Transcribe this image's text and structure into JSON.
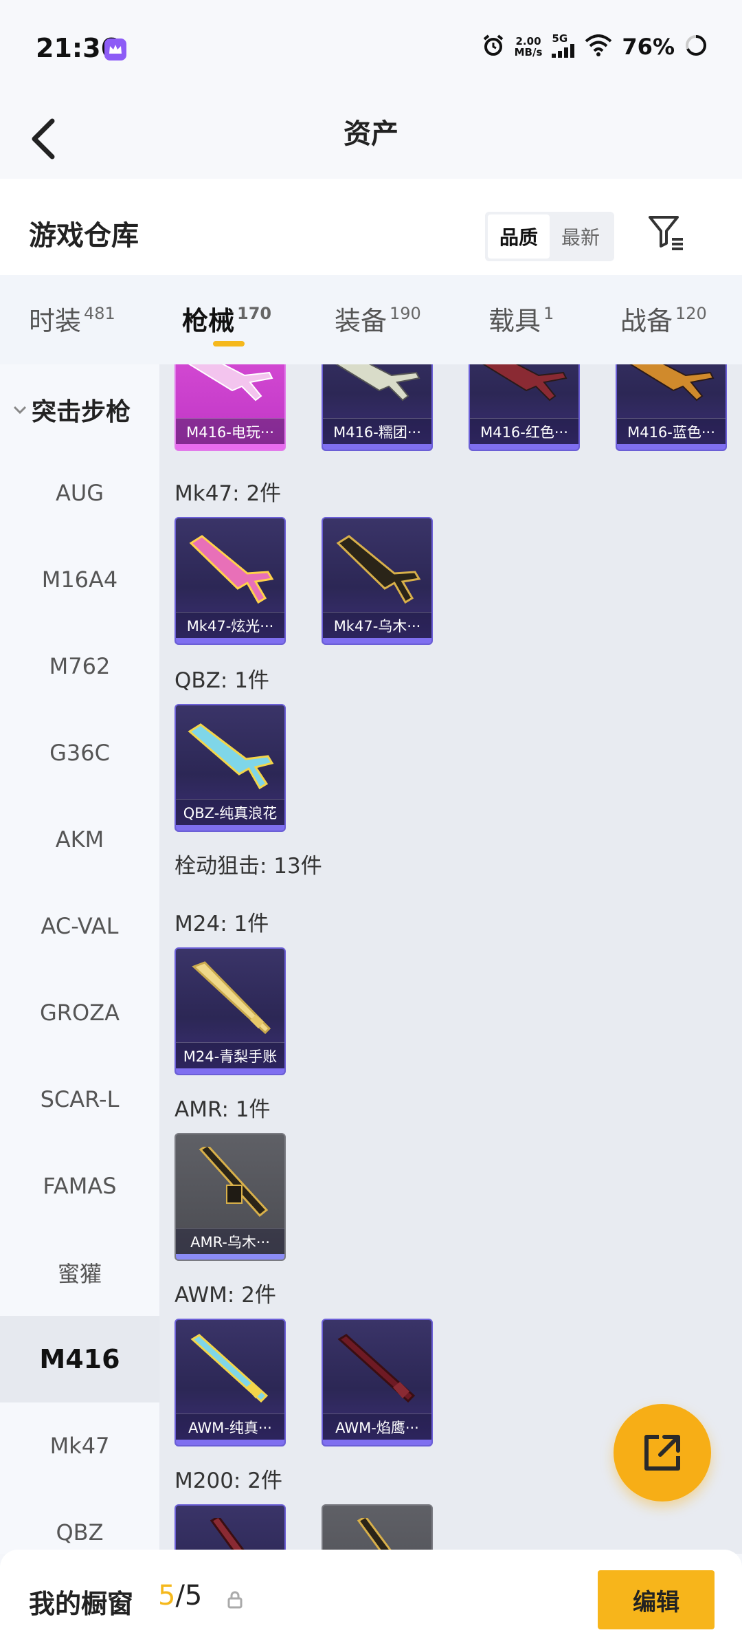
{
  "status_bar": {
    "time": "21:36",
    "net_speed_value": "2.00",
    "net_speed_unit": "MB/s",
    "network": "5G",
    "battery": "76%"
  },
  "header": {
    "title": "资产"
  },
  "warehouse": {
    "title": "游戏仓库",
    "sort_options": [
      "品质",
      "最新"
    ],
    "sort_selected": "品质"
  },
  "tabs": [
    {
      "label": "时装",
      "count": "481"
    },
    {
      "label": "枪械",
      "count": "170"
    },
    {
      "label": "装备",
      "count": "190"
    },
    {
      "label": "载具",
      "count": "1"
    },
    {
      "label": "战备",
      "count": "120"
    }
  ],
  "active_tab": "枪械",
  "sidebar": {
    "group": "突击步枪",
    "items": [
      "AUG",
      "M16A4",
      "M762",
      "G36C",
      "AKM",
      "AC-VAL",
      "GROZA",
      "SCAR-L",
      "FAMAS",
      "蜜獾",
      "M416",
      "Mk47",
      "QBZ"
    ],
    "selected": "M416"
  },
  "content": {
    "m416_cards": [
      "M416-电玩···",
      "M416-糯团···",
      "M416-红色···",
      "M416-蓝色···"
    ],
    "mk47": {
      "label": "Mk47: 2件",
      "cards": [
        "Mk47-炫光···",
        "Mk47-乌木···"
      ]
    },
    "qbz": {
      "label": "QBZ: 1件",
      "cards": [
        "QBZ-纯真浪花"
      ]
    },
    "sniper_group": "栓动狙击: 13件",
    "m24": {
      "label": "M24: 1件",
      "cards": [
        "M24-青梨手账"
      ]
    },
    "amr": {
      "label": "AMR: 1件",
      "cards": [
        "AMR-乌木···"
      ]
    },
    "awm": {
      "label": "AWM: 2件",
      "cards": [
        "AWM-纯真···",
        "AWM-焰鹰···"
      ]
    },
    "m200": {
      "label": "M200: 2件"
    }
  },
  "bottom": {
    "showcase_title": "我的橱窗",
    "showcase_current": "5",
    "showcase_total": "/5",
    "edit_label": "编辑"
  },
  "colors": {
    "accent": "#f5b81c",
    "card_purple": "#2c2755",
    "card_pink": "#c036c6",
    "card_gray": "#4a4b51"
  }
}
